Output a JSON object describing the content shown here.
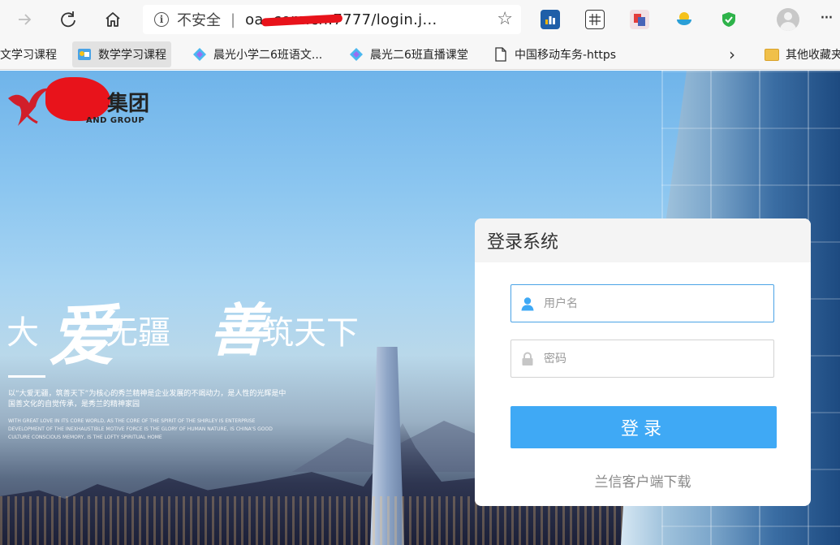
{
  "browser": {
    "back_icon": "arrow-left-icon",
    "forward_icon": "arrow-right-icon",
    "refresh_icon": "refresh-icon",
    "home_icon": "home-icon",
    "security_label": "不安全",
    "separator": "|",
    "url_prefix": "oa",
    "url_visible": "oa                 .com.cn:7777/login.j...",
    "favorite_icon": "star-icon",
    "extensions": [
      "chart-extension-icon",
      "calculator-extension-icon",
      "pdf-extension-icon",
      "bowl-extension-icon",
      "shield-extension-icon"
    ],
    "more_label": "···"
  },
  "bookmarks": {
    "items": [
      {
        "label": "文学习课程"
      },
      {
        "label": "数学学习课程"
      },
      {
        "label": "晨光小学二6班语文..."
      },
      {
        "label": "晨光二6班直播课堂"
      },
      {
        "label": "中国移动车务-https"
      }
    ],
    "overflow_label": "›",
    "other_folder_label": "其他收藏夹"
  },
  "page": {
    "logo": {
      "cn": "集团",
      "en": "AND GROUP"
    },
    "slogan": {
      "c1": "大",
      "c2": "爱",
      "c3": "无疆",
      "c4": "善",
      "c5": "筑天下"
    },
    "description_cn": "以“大爱无疆，筑善天下”为核心的秀兰精神是企业发展的不竭动力，是人性的光辉是中国善文化的自觉传承，是秀兰的精神家园",
    "description_en": "WITH GREAT LOVE IN ITS CORE WORLD, AS THE CORE OF THE SPIRIT OF THE SHIRLEY IS ENTERPRISE DEVELOPMENT OF THE INEXHAUSTIBLE MOTIVE FORCE IS THE GLORY OF HUMAN NATURE, IS CHINA'S GOOD CULTURE CONSCIOUS MEMORY, IS THE LOFTY SPIRITUAL HOME"
  },
  "login": {
    "title": "登录系统",
    "username_placeholder": "用户名",
    "username_value": "",
    "password_placeholder": "密码",
    "password_value": "",
    "submit_label": "登录",
    "download_label": "兰信客户端下载"
  },
  "colors": {
    "accent": "#3fa9f5",
    "focus_border": "#4aa3e6",
    "redaction": "#e8131b"
  }
}
